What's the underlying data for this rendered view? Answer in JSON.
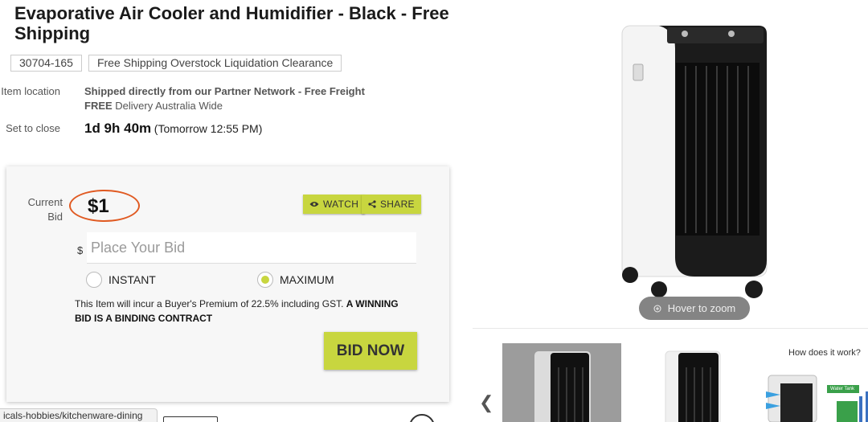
{
  "product": {
    "title": "Evaporative Air Cooler and Humidifier - Black - Free Shipping",
    "lot_number": "30704-165",
    "category_tag": "Free Shipping Overstock Liquidation Clearance"
  },
  "details": {
    "location_label": "Item location",
    "location_line1": "Shipped directly from our Partner Network - Free Freight",
    "location_free": "FREE",
    "location_line2_rest": " Delivery Australia Wide",
    "close_label": "Set to close",
    "countdown": "1d 9h 40m",
    "close_time": "(Tomorrow 12:55 PM)"
  },
  "bid": {
    "current_bid_label": "Current Bid",
    "current_bid": "$1",
    "watch_label": "WATCH",
    "share_label": "SHARE",
    "currency_symbol": "$",
    "input_placeholder": "Place Your Bid",
    "instant_label": "INSTANT",
    "maximum_label": "MAXIMUM",
    "selected_mode": "maximum",
    "premium_text": "This Item will incur a Buyer's Premium of 22.5% including GST. ",
    "premium_bold": "A WINNING BID IS A BINDING CONTRACT",
    "bid_now_label": "BID NOW"
  },
  "gallery": {
    "zoom_label": "Hover to zoom",
    "thumb3_title": "How does it work?",
    "thumb3_badge": "Water Tank"
  },
  "browser": {
    "status_url": "icals-hobbies/kitchenware-dining"
  },
  "colors": {
    "accent": "#c8d63f",
    "highlight_ring": "#e05a22"
  },
  "icons": [
    "eye-icon",
    "share-icon",
    "zoom-icon",
    "chevron-left-icon"
  ]
}
